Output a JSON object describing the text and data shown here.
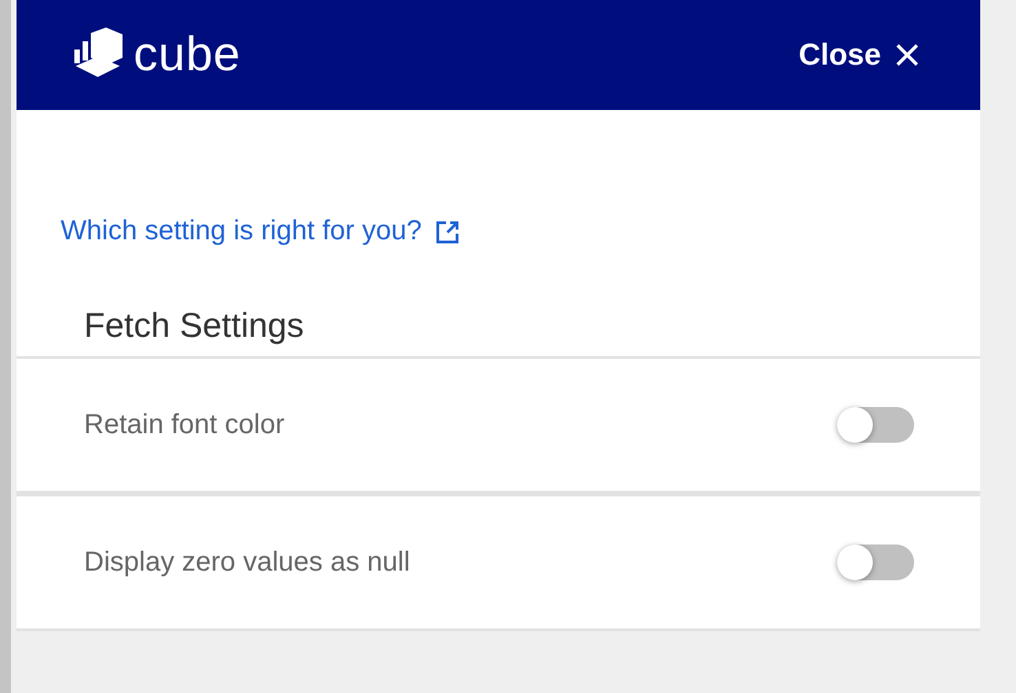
{
  "header": {
    "logo_text": "cube",
    "close_label": "Close"
  },
  "help_link": "Which setting is right for you?",
  "section": {
    "title": "Fetch Settings"
  },
  "settings": [
    {
      "label": "Retain font color",
      "on": false
    },
    {
      "label": "Display zero values as null",
      "on": false
    }
  ]
}
